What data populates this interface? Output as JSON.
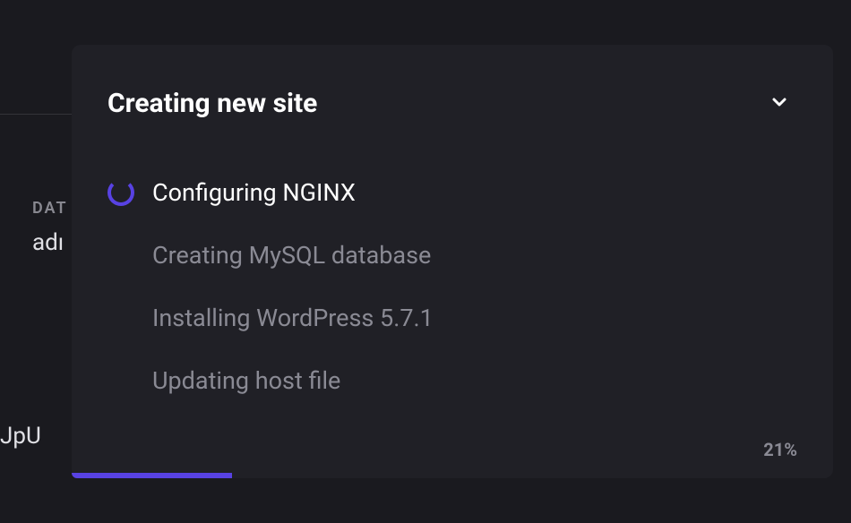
{
  "background": {
    "label": "DAT",
    "text1": "adı",
    "text2": "JpU"
  },
  "panel": {
    "title": "Creating new site",
    "steps": [
      {
        "label": "Configuring NGINX",
        "status": "active"
      },
      {
        "label": "Creating MySQL database",
        "status": "pending"
      },
      {
        "label": "Installing WordPress 5.7.1",
        "status": "pending"
      },
      {
        "label": "Updating host file",
        "status": "pending"
      }
    ],
    "progress": {
      "percent_label": "21%",
      "percent_value": 21
    }
  }
}
